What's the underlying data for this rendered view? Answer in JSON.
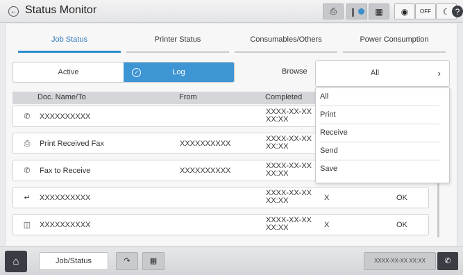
{
  "header": {
    "back_icon": "circle-left-arrow-icon",
    "title": "Status Monitor",
    "icons": [
      "printer-icon",
      "network-icon",
      "memory-card-icon",
      "sound-icon",
      "wifi-off-icon",
      "sleep-moon-icon",
      "help-icon"
    ]
  },
  "tabs": [
    {
      "label": "Job Status",
      "active": true
    },
    {
      "label": "Printer Status",
      "active": false
    },
    {
      "label": "Consumables/Others",
      "active": false
    },
    {
      "label": "Power Consumption",
      "active": false
    }
  ],
  "toggle": {
    "active_label": "Active",
    "log_label": "Log",
    "selected": "Log"
  },
  "browse_label": "Browse",
  "dropdown": {
    "selected": "All",
    "options": [
      "All",
      "Print",
      "Receive",
      "Send",
      "Save"
    ]
  },
  "table": {
    "columns": {
      "name": "Doc. Name/To",
      "from": "From",
      "completed": "Completed"
    },
    "rows": [
      {
        "icon": "fax-send-icon",
        "name": "XXXXXXXXXX",
        "from": "",
        "date": "XXXX-XX-XX",
        "time": "XX:XX",
        "result_x": "",
        "result": ""
      },
      {
        "icon": "print-received-fax-icon",
        "name": "Print Received Fax",
        "from": "XXXXXXXXXX",
        "date": "XXXX-XX-XX",
        "time": "XX:XX",
        "result_x": "",
        "result": ""
      },
      {
        "icon": "fax-receive-icon",
        "name": "Fax to Receive",
        "from": "XXXXXXXXXX",
        "date": "XXXX-XX-XX",
        "time": "XX:XX",
        "result_x": "",
        "result": ""
      },
      {
        "icon": "scan-to-folder-icon",
        "name": "XXXXXXXXXX",
        "from": "",
        "date": "XXXX-XX-XX",
        "time": "XX:XX",
        "result_x": "X",
        "result": "OK"
      },
      {
        "icon": "copy-save-icon",
        "name": "XXXXXXXXXX",
        "from": "",
        "date": "XXXX-XX-XX",
        "time": "XX:XX",
        "result_x": "X",
        "result": "OK"
      }
    ]
  },
  "bottom": {
    "home_icon": "home-icon",
    "job_status_label": "Job/Status",
    "clock_text": "XXXX-XX-XX XX:XX",
    "fax_icon": "fax-icon"
  },
  "colors": {
    "accent": "#3d95d4",
    "tab_active": "#2a8ccd",
    "dark": "#3b3d44"
  }
}
